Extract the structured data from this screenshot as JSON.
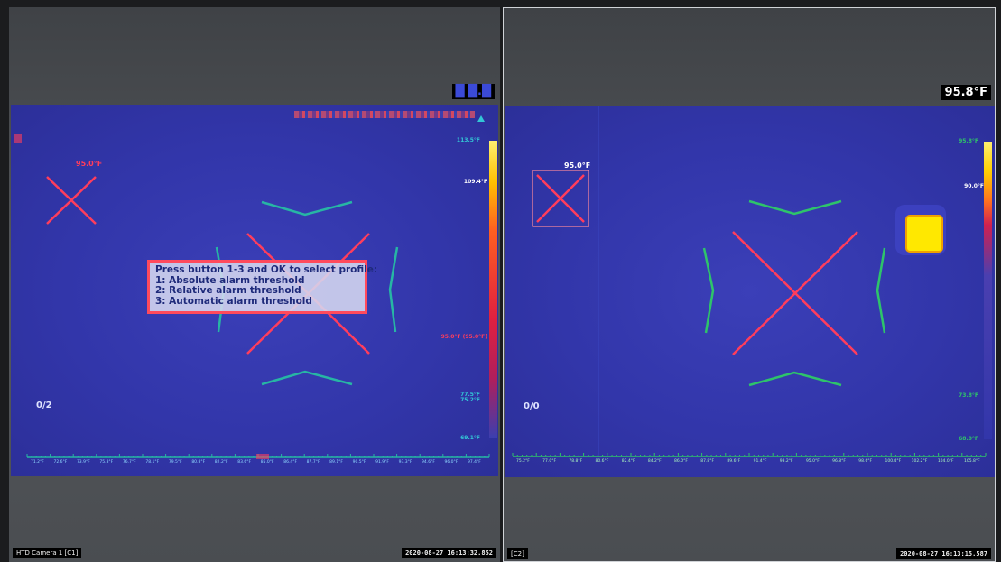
{
  "panels": [
    {
      "camera_label": "HTD Camera 1 [C1]",
      "timestamp": "2020-08-27 16:13:32.852",
      "spot_temp": "95.0°F",
      "counter": "0/2",
      "palette_top": "113.5°F",
      "palette_marker": "109.4°F",
      "palette_alarm": "95.0°F (95.0°F)",
      "palette_mid_a": "77.5°F",
      "palette_mid_b": "75.2°F",
      "palette_bottom": "69.1°F",
      "profile_menu": {
        "title": "Press button 1-3 and OK to select profile:",
        "options": [
          "1: Absolute alarm threshold",
          "2: Relative alarm threshold",
          "3: Automatic alarm threshold"
        ]
      },
      "scale_ticks": [
        "71.2°F",
        "72.6°F",
        "73.9°F",
        "75.3°F",
        "76.7°F",
        "78.1°F",
        "79.5°F",
        "80.8°F",
        "82.2°F",
        "83.6°F",
        "85.0°F",
        "86.4°F",
        "87.7°F",
        "89.1°F",
        "90.5°F",
        "91.9°F",
        "93.3°F",
        "94.6°F",
        "96.0°F",
        "97.4°F"
      ]
    },
    {
      "camera_label": "[C2]",
      "timestamp": "2020-08-27 16:13:15.587",
      "max_temp": "95.8°F",
      "spot_temp": "95.0°F",
      "counter": "0/0",
      "palette_top": "95.8°F",
      "palette_marker": "90.0°F",
      "palette_mid": "73.8°F",
      "palette_bottom": "68.0°F",
      "scale_ticks": [
        "75.2°F",
        "77.0°F",
        "78.8°F",
        "80.6°F",
        "82.4°F",
        "84.2°F",
        "86.0°F",
        "87.8°F",
        "89.6°F",
        "91.4°F",
        "93.2°F",
        "95.0°F",
        "96.8°F",
        "98.6°F",
        "100.4°F",
        "102.2°F",
        "104.0°F",
        "105.8°F"
      ]
    }
  ],
  "colors": {
    "alarm": "#ff3d5c",
    "guide_teal": "#27b6a4",
    "guide_green": "#2ec46a",
    "hotspot": "#ffe800"
  }
}
